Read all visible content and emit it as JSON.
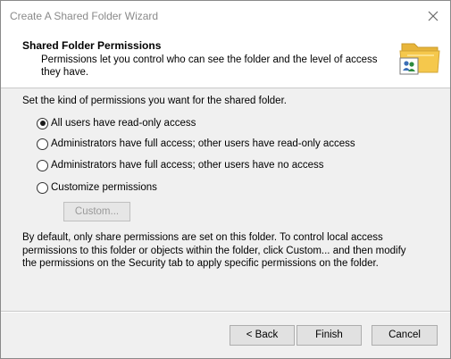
{
  "window": {
    "title": "Create A Shared Folder Wizard",
    "close_icon": "close-icon"
  },
  "header": {
    "title": "Shared Folder Permissions",
    "subtitle": "Permissions let you control who can see the folder and the level of access they have.",
    "icon": "shared-folder-icon"
  },
  "body": {
    "prompt": "Set the kind of permissions you want for the shared folder.",
    "options": [
      {
        "label": "All users have read-only access",
        "checked": true
      },
      {
        "label": "Administrators have full access; other users have read-only access",
        "checked": false
      },
      {
        "label": "Administrators have full access; other users have no access",
        "checked": false
      },
      {
        "label": "Customize permissions",
        "checked": false
      }
    ],
    "custom_button": "Custom...",
    "info": "By default, only share permissions are set on this folder. To control local access permissions to this folder or objects within the folder, click Custom... and then modify the permissions on the Security tab to apply specific permissions on the folder."
  },
  "footer": {
    "back": "< Back",
    "finish": "Finish",
    "cancel": "Cancel"
  },
  "colors": {
    "title_text": "#8a8a8a",
    "dialog_bg": "#f0f0f0",
    "header_bg": "#ffffff",
    "folder_yellow": "#f5c84c"
  }
}
